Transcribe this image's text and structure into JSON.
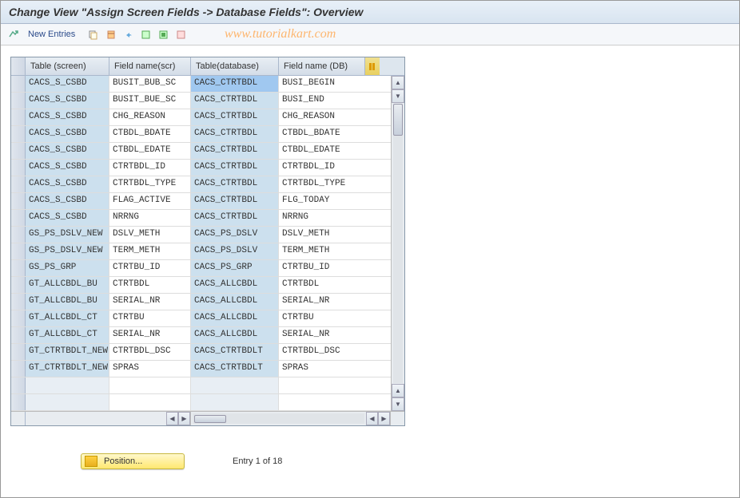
{
  "title": "Change View \"Assign Screen Fields -> Database Fields\": Overview",
  "toolbar": {
    "new_entries": "New Entries"
  },
  "watermark": "www.tutorialkart.com",
  "columns": {
    "c1": "Table (screen)",
    "c2": "Field name(scr)",
    "c3": "Table(database)",
    "c4": "Field name (DB)"
  },
  "rows": [
    {
      "c1": "CACS_S_CSBD",
      "c2": "BUSIT_BUB_SC",
      "c3": "CACS_CTRTBDL",
      "c4": "BUSI_BEGIN",
      "selected": true
    },
    {
      "c1": "CACS_S_CSBD",
      "c2": "BUSIT_BUE_SC",
      "c3": "CACS_CTRTBDL",
      "c4": "BUSI_END"
    },
    {
      "c1": "CACS_S_CSBD",
      "c2": "CHG_REASON",
      "c3": "CACS_CTRTBDL",
      "c4": "CHG_REASON"
    },
    {
      "c1": "CACS_S_CSBD",
      "c2": "CTBDL_BDATE",
      "c3": "CACS_CTRTBDL",
      "c4": "CTBDL_BDATE"
    },
    {
      "c1": "CACS_S_CSBD",
      "c2": "CTBDL_EDATE",
      "c3": "CACS_CTRTBDL",
      "c4": "CTBDL_EDATE"
    },
    {
      "c1": "CACS_S_CSBD",
      "c2": "CTRTBDL_ID",
      "c3": "CACS_CTRTBDL",
      "c4": "CTRTBDL_ID"
    },
    {
      "c1": "CACS_S_CSBD",
      "c2": "CTRTBDL_TYPE",
      "c3": "CACS_CTRTBDL",
      "c4": "CTRTBDL_TYPE"
    },
    {
      "c1": "CACS_S_CSBD",
      "c2": "FLAG_ACTIVE",
      "c3": "CACS_CTRTBDL",
      "c4": "FLG_TODAY"
    },
    {
      "c1": "CACS_S_CSBD",
      "c2": "NRRNG",
      "c3": "CACS_CTRTBDL",
      "c4": "NRRNG"
    },
    {
      "c1": "GS_PS_DSLV_NEW",
      "c2": "DSLV_METH",
      "c3": "CACS_PS_DSLV",
      "c4": "DSLV_METH"
    },
    {
      "c1": "GS_PS_DSLV_NEW",
      "c2": "TERM_METH",
      "c3": "CACS_PS_DSLV",
      "c4": "TERM_METH"
    },
    {
      "c1": "GS_PS_GRP",
      "c2": "CTRTBU_ID",
      "c3": "CACS_PS_GRP",
      "c4": "CTRTBU_ID"
    },
    {
      "c1": "GT_ALLCBDL_BU",
      "c2": "CTRTBDL",
      "c3": "CACS_ALLCBDL",
      "c4": "CTRTBDL"
    },
    {
      "c1": "GT_ALLCBDL_BU",
      "c2": "SERIAL_NR",
      "c3": "CACS_ALLCBDL",
      "c4": "SERIAL_NR"
    },
    {
      "c1": "GT_ALLCBDL_CT",
      "c2": "CTRTBU",
      "c3": "CACS_ALLCBDL",
      "c4": "CTRTBU"
    },
    {
      "c1": "GT_ALLCBDL_CT",
      "c2": "SERIAL_NR",
      "c3": "CACS_ALLCBDL",
      "c4": "SERIAL_NR"
    },
    {
      "c1": "GT_CTRTBDLT_NEW",
      "c2": "CTRTBDL_DSC",
      "c3": "CACS_CTRTBDLT",
      "c4": "CTRTBDL_DSC"
    },
    {
      "c1": "GT_CTRTBDLT_NEW",
      "c2": "SPRAS",
      "c3": "CACS_CTRTBDLT",
      "c4": "SPRAS"
    }
  ],
  "empty_rows": 2,
  "position_label": "Position...",
  "entry_info": "Entry 1 of 18"
}
